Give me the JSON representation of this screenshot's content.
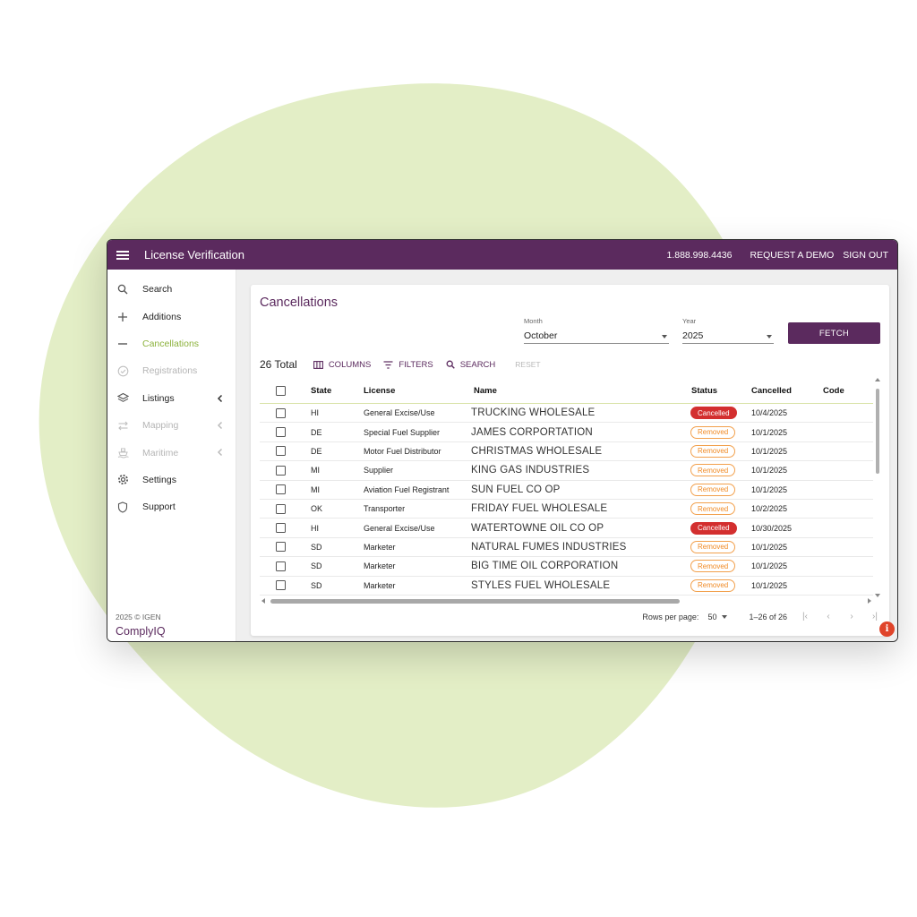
{
  "colors": {
    "brand": "#5b2a5e",
    "active_nav": "#8cb23c",
    "blob": "#e3eec6",
    "cancelled": "#d32f2f",
    "removed": "#f08a24"
  },
  "topbar": {
    "title": "License Verification",
    "phone": "1.888.998.4436",
    "request_demo": "REQUEST A DEMO",
    "sign_out": "SIGN OUT"
  },
  "sidebar": {
    "items": [
      {
        "label": "Search",
        "icon": "search-icon"
      },
      {
        "label": "Additions",
        "icon": "plus-icon"
      },
      {
        "label": "Cancellations",
        "icon": "minus-icon"
      },
      {
        "label": "Registrations",
        "icon": "check-circle-icon"
      },
      {
        "label": "Listings",
        "icon": "layers-icon"
      },
      {
        "label": "Mapping",
        "icon": "swap-icon"
      },
      {
        "label": "Maritime",
        "icon": "ship-icon"
      },
      {
        "label": "Settings",
        "icon": "gear-icon"
      },
      {
        "label": "Support",
        "icon": "shield-icon"
      }
    ],
    "footer": {
      "copyright": "2025 © IGEN",
      "brand": "ComplyIQ"
    }
  },
  "page": {
    "title": "Cancellations",
    "month": {
      "label": "Month",
      "value": "October"
    },
    "year": {
      "label": "Year",
      "value": "2025"
    },
    "fetch_label": "FETCH"
  },
  "toolbar": {
    "total": "26 Total",
    "columns": "COLUMNS",
    "filters": "FILTERS",
    "search": "SEARCH",
    "reset": "RESET"
  },
  "table": {
    "columns": [
      "State",
      "License",
      "Name",
      "Status",
      "Cancelled",
      "Code"
    ],
    "rows": [
      {
        "state": "HI",
        "license": "General Excise/Use",
        "name": "TRUCKING WHOLESALE",
        "status": "Cancelled",
        "cancelled": "10/4/2025"
      },
      {
        "state": "DE",
        "license": "Special Fuel Supplier",
        "name": "JAMES CORPORTATION",
        "status": "Removed",
        "cancelled": "10/1/2025"
      },
      {
        "state": "DE",
        "license": "Motor Fuel Distributor",
        "name": "CHRISTMAS WHOLESALE",
        "status": "Removed",
        "cancelled": "10/1/2025"
      },
      {
        "state": "MI",
        "license": "Supplier",
        "name": "KING GAS INDUSTRIES",
        "status": "Removed",
        "cancelled": "10/1/2025"
      },
      {
        "state": "MI",
        "license": "Aviation Fuel Registrant",
        "name": "SUN FUEL CO OP",
        "status": "Removed",
        "cancelled": "10/1/2025"
      },
      {
        "state": "OK",
        "license": "Transporter",
        "name": "FRIDAY FUEL WHOLESALE",
        "status": "Removed",
        "cancelled": "10/2/2025"
      },
      {
        "state": "HI",
        "license": "General Excise/Use",
        "name": "WATERTOWNE OIL CO OP",
        "status": "Cancelled",
        "cancelled": "10/30/2025"
      },
      {
        "state": "SD",
        "license": "Marketer",
        "name": "NATURAL FUMES INDUSTRIES",
        "status": "Removed",
        "cancelled": "10/1/2025"
      },
      {
        "state": "SD",
        "license": "Marketer",
        "name": "BIG TIME OIL CORPORATION",
        "status": "Removed",
        "cancelled": "10/1/2025"
      },
      {
        "state": "SD",
        "license": "Marketer",
        "name": "STYLES FUEL WHOLESALE",
        "status": "Removed",
        "cancelled": "10/1/2025"
      }
    ]
  },
  "pagination": {
    "rows_per_page_label": "Rows per page:",
    "rows_per_page": "50",
    "range": "1–26 of 26"
  },
  "help_badge": "i"
}
